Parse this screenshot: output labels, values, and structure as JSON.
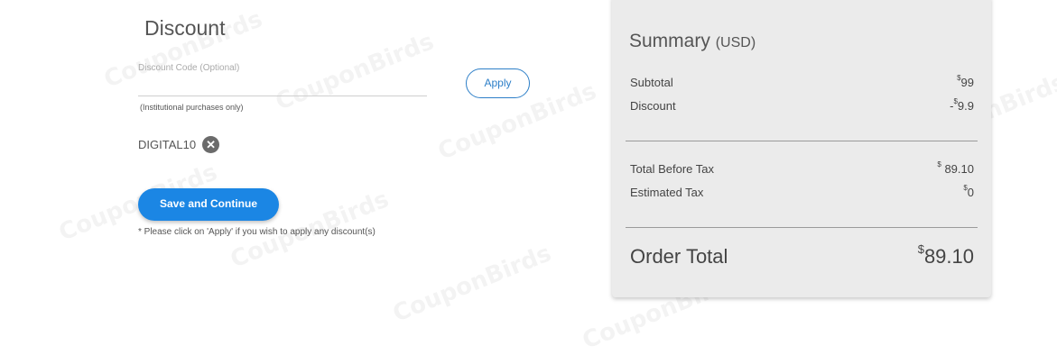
{
  "watermark": "CouponBirds",
  "discount": {
    "title": "Discount",
    "field_label": "Discount Code",
    "field_label_optional": "(Optional)",
    "input_value": "",
    "apply_label": "Apply",
    "help_text": "(Institutional purchases only)",
    "applied_code": "DIGITAL10",
    "save_label": "Save and Continue",
    "note": "* Please click on 'Apply' if you wish to apply any discount(s)"
  },
  "summary": {
    "title": "Summary",
    "currency": "(USD)",
    "currency_symbol": "$",
    "subtotal_label": "Subtotal",
    "subtotal_value": "99",
    "discount_label": "Discount",
    "discount_sign": "-",
    "discount_value": "9.9",
    "before_tax_label": "Total Before Tax",
    "before_tax_value": "89.10",
    "tax_label": "Estimated Tax",
    "tax_value": "0",
    "order_total_label": "Order Total",
    "order_total_value": "89.10"
  },
  "colors": {
    "accent": "#1b86e4",
    "apply_border": "#2d7fc8",
    "summary_bg": "#ebebeb"
  }
}
